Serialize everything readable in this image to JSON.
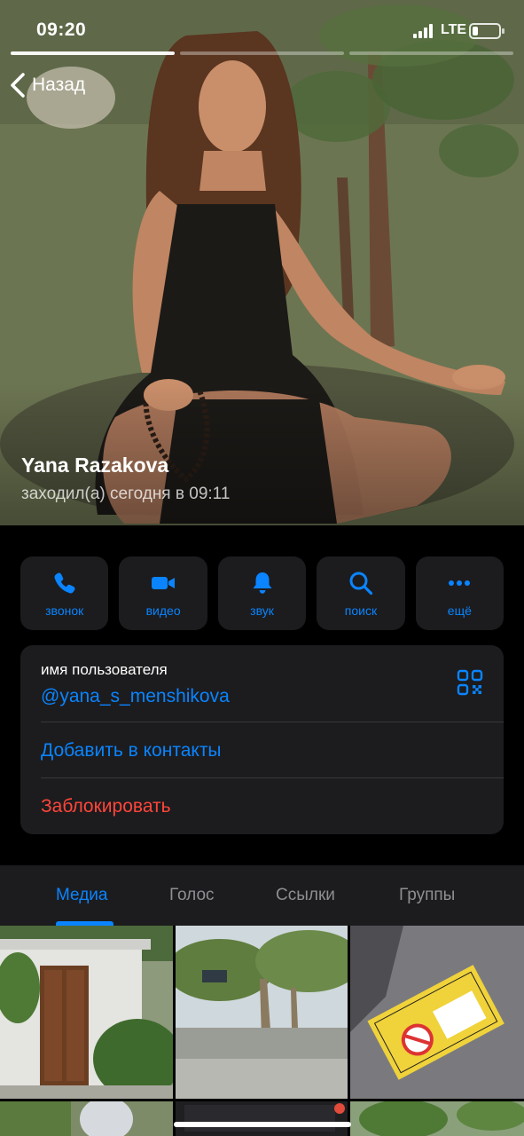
{
  "status_bar": {
    "time": "09:20",
    "network": "LTE",
    "battery_level": 0.2
  },
  "story": {
    "segments": 3,
    "active_index": 0
  },
  "nav": {
    "back_label": "Назад"
  },
  "profile": {
    "name": "Yana Razakova",
    "last_seen": "заходил(а) сегодня в 09:11"
  },
  "actions": [
    {
      "label": "звонок",
      "icon": "phone-icon"
    },
    {
      "label": "видео",
      "icon": "video-camera-icon"
    },
    {
      "label": "звук",
      "icon": "bell-icon"
    },
    {
      "label": "поиск",
      "icon": "search-icon"
    },
    {
      "label": "ещё",
      "icon": "more-dots-icon"
    }
  ],
  "info": {
    "username_label": "имя пользователя",
    "username": "@yana_s_menshikova",
    "add_contact": "Добавить в контакты",
    "block": "Заблокировать"
  },
  "tabs": [
    {
      "label": "Медиа",
      "active": true
    },
    {
      "label": "Голос",
      "active": false
    },
    {
      "label": "Ссылки",
      "active": false
    },
    {
      "label": "Группы",
      "active": false
    }
  ],
  "colors": {
    "accent": "#0a84ff",
    "danger": "#ff453a",
    "card": "#1c1c1e",
    "secondary_text": "#8e8e93"
  }
}
